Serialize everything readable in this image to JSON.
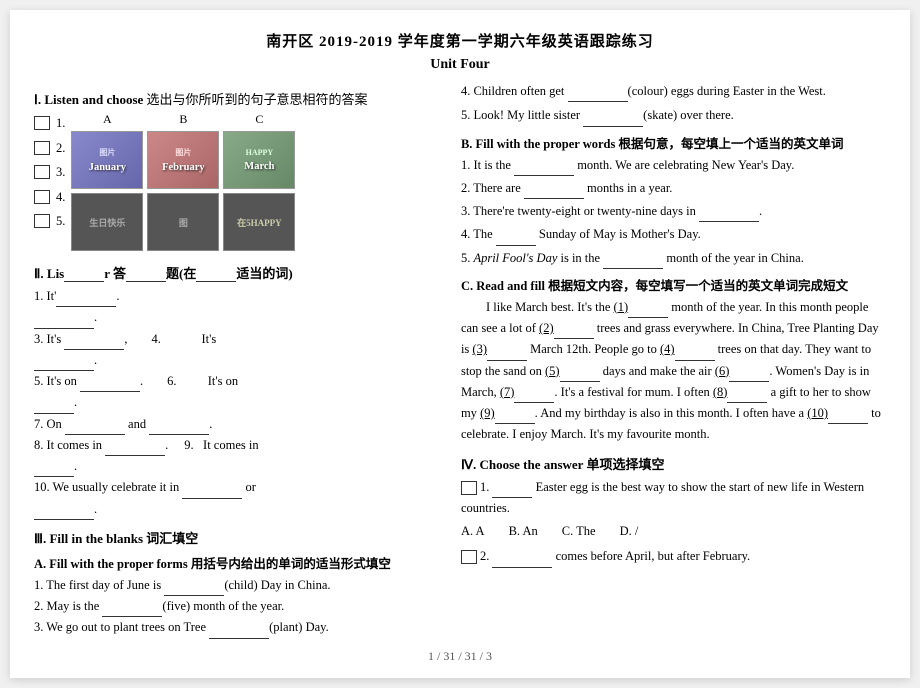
{
  "page": {
    "title": "南开区 2019-2019 学年度第一学期六年级英语跟踪练习",
    "unit": "Unit Four",
    "footer": "1 / 31 / 31 / 3"
  },
  "left": {
    "section1": {
      "title": "Ⅰ. Listen and choose 选出与你所听到的句子意思相符的答案",
      "items": [
        "( )1.",
        "( )2.",
        "( )3.",
        "( )4.",
        "( )5."
      ],
      "cols": [
        "A",
        "B",
        "C"
      ],
      "images": [
        {
          "label": "January",
          "sub": ""
        },
        {
          "label": "February",
          "sub": ""
        },
        {
          "label": "March",
          "sub": "HAPPY"
        }
      ]
    },
    "section2": {
      "title": "Ⅱ. Lis____ r 答案___题(在___当的词)",
      "line1": "1. It'_______________.",
      "line2": "______.",
      "line3": "3. It's __________,",
      "line4_label": "4.",
      "line4_end": "It's",
      "line5_label": "5. It's on __________.",
      "line6_label": "6.",
      "line6_end": "It's on",
      "line7": "7. On __________ and __________.",
      "line8": "8. It comes in __________.",
      "line9_label": "9.",
      "line9_end": "It comes in",
      "line10": "10. We usually celebrate it in _____________ or"
    },
    "section3": {
      "title": "Ⅲ. Fill in the blanks 词汇填空",
      "subA": {
        "title": "A. Fill with the proper forms 用括号内给出的单词的适当形式填空",
        "items": [
          "1. The first day of June is ___________(child) Day in China.",
          "2. May is the ___________(five) month of the year.",
          "3. We go out to plant trees on Tree ___________(plant) Day."
        ]
      }
    }
  },
  "right": {
    "q4": "4.  Children often get ____________(colour) eggs during Easter in the West.",
    "q5": "5.  Look! My little sister ____________(skate) over there.",
    "subB": {
      "title": "B. Fill with the proper words 根据句意，每空填上一个适当的英文单词",
      "items": [
        "1.  It is the _________ month. We are celebrating New Year's Day.",
        "2.  There are _____________ months in a year.",
        "3.  There're twenty-eight or twenty-nine days in __________.",
        "4.  The __________ Sunday of May is Mother's Day.",
        "5.  April Fool's Day is in the __________ month of the year in China."
      ]
    },
    "subC": {
      "title": "C. Read and fill 根据短文内容，每空填写一个适当的英文单词完成短文",
      "text_before": "I like March best. It's the ",
      "blanks": [
        "(1)",
        "(2)",
        "(3)",
        "(4)",
        "(5)",
        "(6)",
        "(7)",
        "(8)",
        "(9)",
        "(10)"
      ],
      "text": "I like March best. It's the (1)________ month of the year. In this month people can see a lot of (2)________ trees and grass everywhere. In China, Tree Planting Day is (3)________ March 12th. People go to (4)________ trees on that day. They want to stop the sand on (5)________ days and make the air (6)________. Women's Day is in March, (7)________. It's a festival for mum. I often (8)________ a gift to her to show my (9)________. And my birthday is also in this month. I often have a (10)________ to celebrate. I enjoy March. It's my favourite month."
    },
    "section4": {
      "title": "Ⅳ. Choose the answer 单项选择填空",
      "items": [
        {
          "num": "( )1.",
          "text": "______ Easter egg is the best way to show the start of new life in Western countries.",
          "options": [
            "A. A",
            "B. An",
            "C. The",
            "D. /"
          ]
        },
        {
          "num": "( )2.",
          "text": "_______ comes before April, but after February.",
          "options": []
        }
      ]
    }
  }
}
